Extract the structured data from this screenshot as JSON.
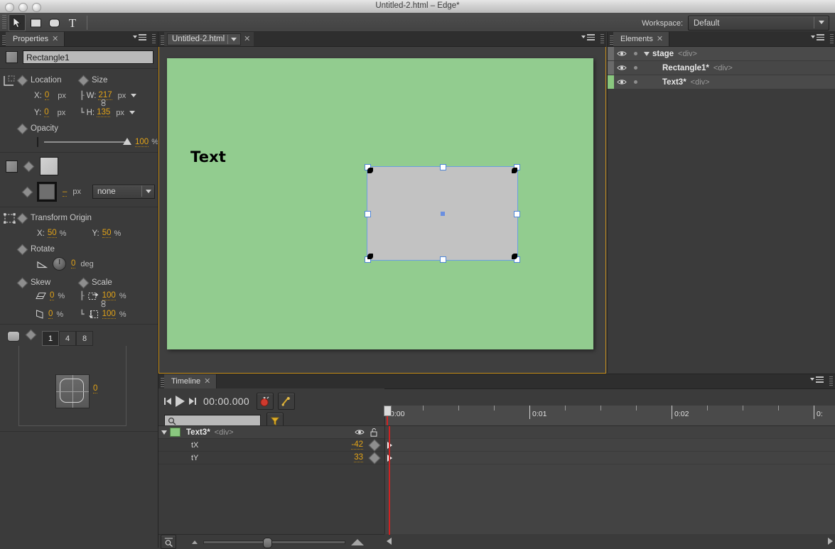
{
  "window": {
    "title": "Untitled-2.html – Edge*"
  },
  "toolbar": {
    "tools": [
      {
        "name": "selection-tool",
        "icon": "arrow-cursor-icon",
        "active": true
      },
      {
        "name": "rectangle-tool",
        "icon": "square-icon",
        "active": false
      },
      {
        "name": "rounded-rectangle-tool",
        "icon": "rounded-square-icon",
        "active": false
      },
      {
        "name": "text-tool",
        "icon": "text-T-icon",
        "active": false
      }
    ],
    "workspace_label": "Workspace:",
    "workspace_value": "Default"
  },
  "properties": {
    "panel_title": "Properties",
    "element_name": "Rectangle1",
    "location": {
      "label": "Location",
      "x_label": "X:",
      "x_value": "0",
      "x_unit": "px",
      "y_label": "Y:",
      "y_value": "0",
      "y_unit": "px"
    },
    "size": {
      "label": "Size",
      "w_label": "W:",
      "w_value": "217",
      "w_unit": "px",
      "h_label": "H:",
      "h_value": "135",
      "h_unit": "px"
    },
    "opacity": {
      "label": "Opacity",
      "value": "100",
      "unit": "%"
    },
    "border": {
      "width_value": "–",
      "width_unit": "px",
      "style_value": "none"
    },
    "transform_origin": {
      "label": "Transform Origin",
      "x_label": "X:",
      "x_value": "50",
      "x_unit": "%",
      "y_label": "Y:",
      "y_value": "50",
      "y_unit": "%"
    },
    "rotate": {
      "label": "Rotate",
      "value": "0",
      "unit": "deg"
    },
    "skew": {
      "label": "Skew",
      "x_value": "0",
      "x_unit": "%",
      "y_value": "0",
      "y_unit": "%"
    },
    "scale": {
      "label": "Scale",
      "x_value": "100",
      "x_unit": "%",
      "y_value": "100",
      "y_unit": "%"
    },
    "corner": {
      "presets": [
        "1",
        "4",
        "8"
      ],
      "active_preset": "1",
      "radius_value": "0"
    }
  },
  "document": {
    "tab_label": "Untitled-2.html",
    "stage_text": "Text",
    "stage_bg_color": "#92cc8f",
    "selected_shape_fill": "#c2c2c2",
    "selection_color": "#6a9fe0"
  },
  "elements": {
    "panel_title": "Elements",
    "rows": [
      {
        "name": "stage",
        "tag": "<div>",
        "indent": 0,
        "expanded": true,
        "chip": "none"
      },
      {
        "name": "Rectangle1*",
        "tag": "<div>",
        "indent": 1,
        "expanded": false,
        "chip": "none"
      },
      {
        "name": "Text3*",
        "tag": "<div>",
        "indent": 1,
        "expanded": false,
        "chip": "green"
      }
    ]
  },
  "timeline": {
    "panel_title": "Timeline",
    "timecode": "00:00.000",
    "search_placeholder": "",
    "ruler_labels": [
      "0:00",
      "0:01",
      "0:02",
      "0:"
    ],
    "layer": {
      "name": "Text3*",
      "tag": "<div>",
      "properties": [
        {
          "name": "tX",
          "value": "-42"
        },
        {
          "name": "tY",
          "value": "33"
        }
      ]
    },
    "buttons": {
      "go_start": "go-to-start-button",
      "play": "play-button",
      "go_end": "go-to-end-button",
      "toggle_pin": "toggle-pin-button",
      "auto_keyframe": "auto-keyframe-button",
      "filter": "filter-button"
    }
  },
  "colors": {
    "accent_orange": "#e3a317",
    "stage_border": "#c8901c",
    "playhead_red": "#cf2222",
    "panel_bg": "#3b3b3b"
  }
}
